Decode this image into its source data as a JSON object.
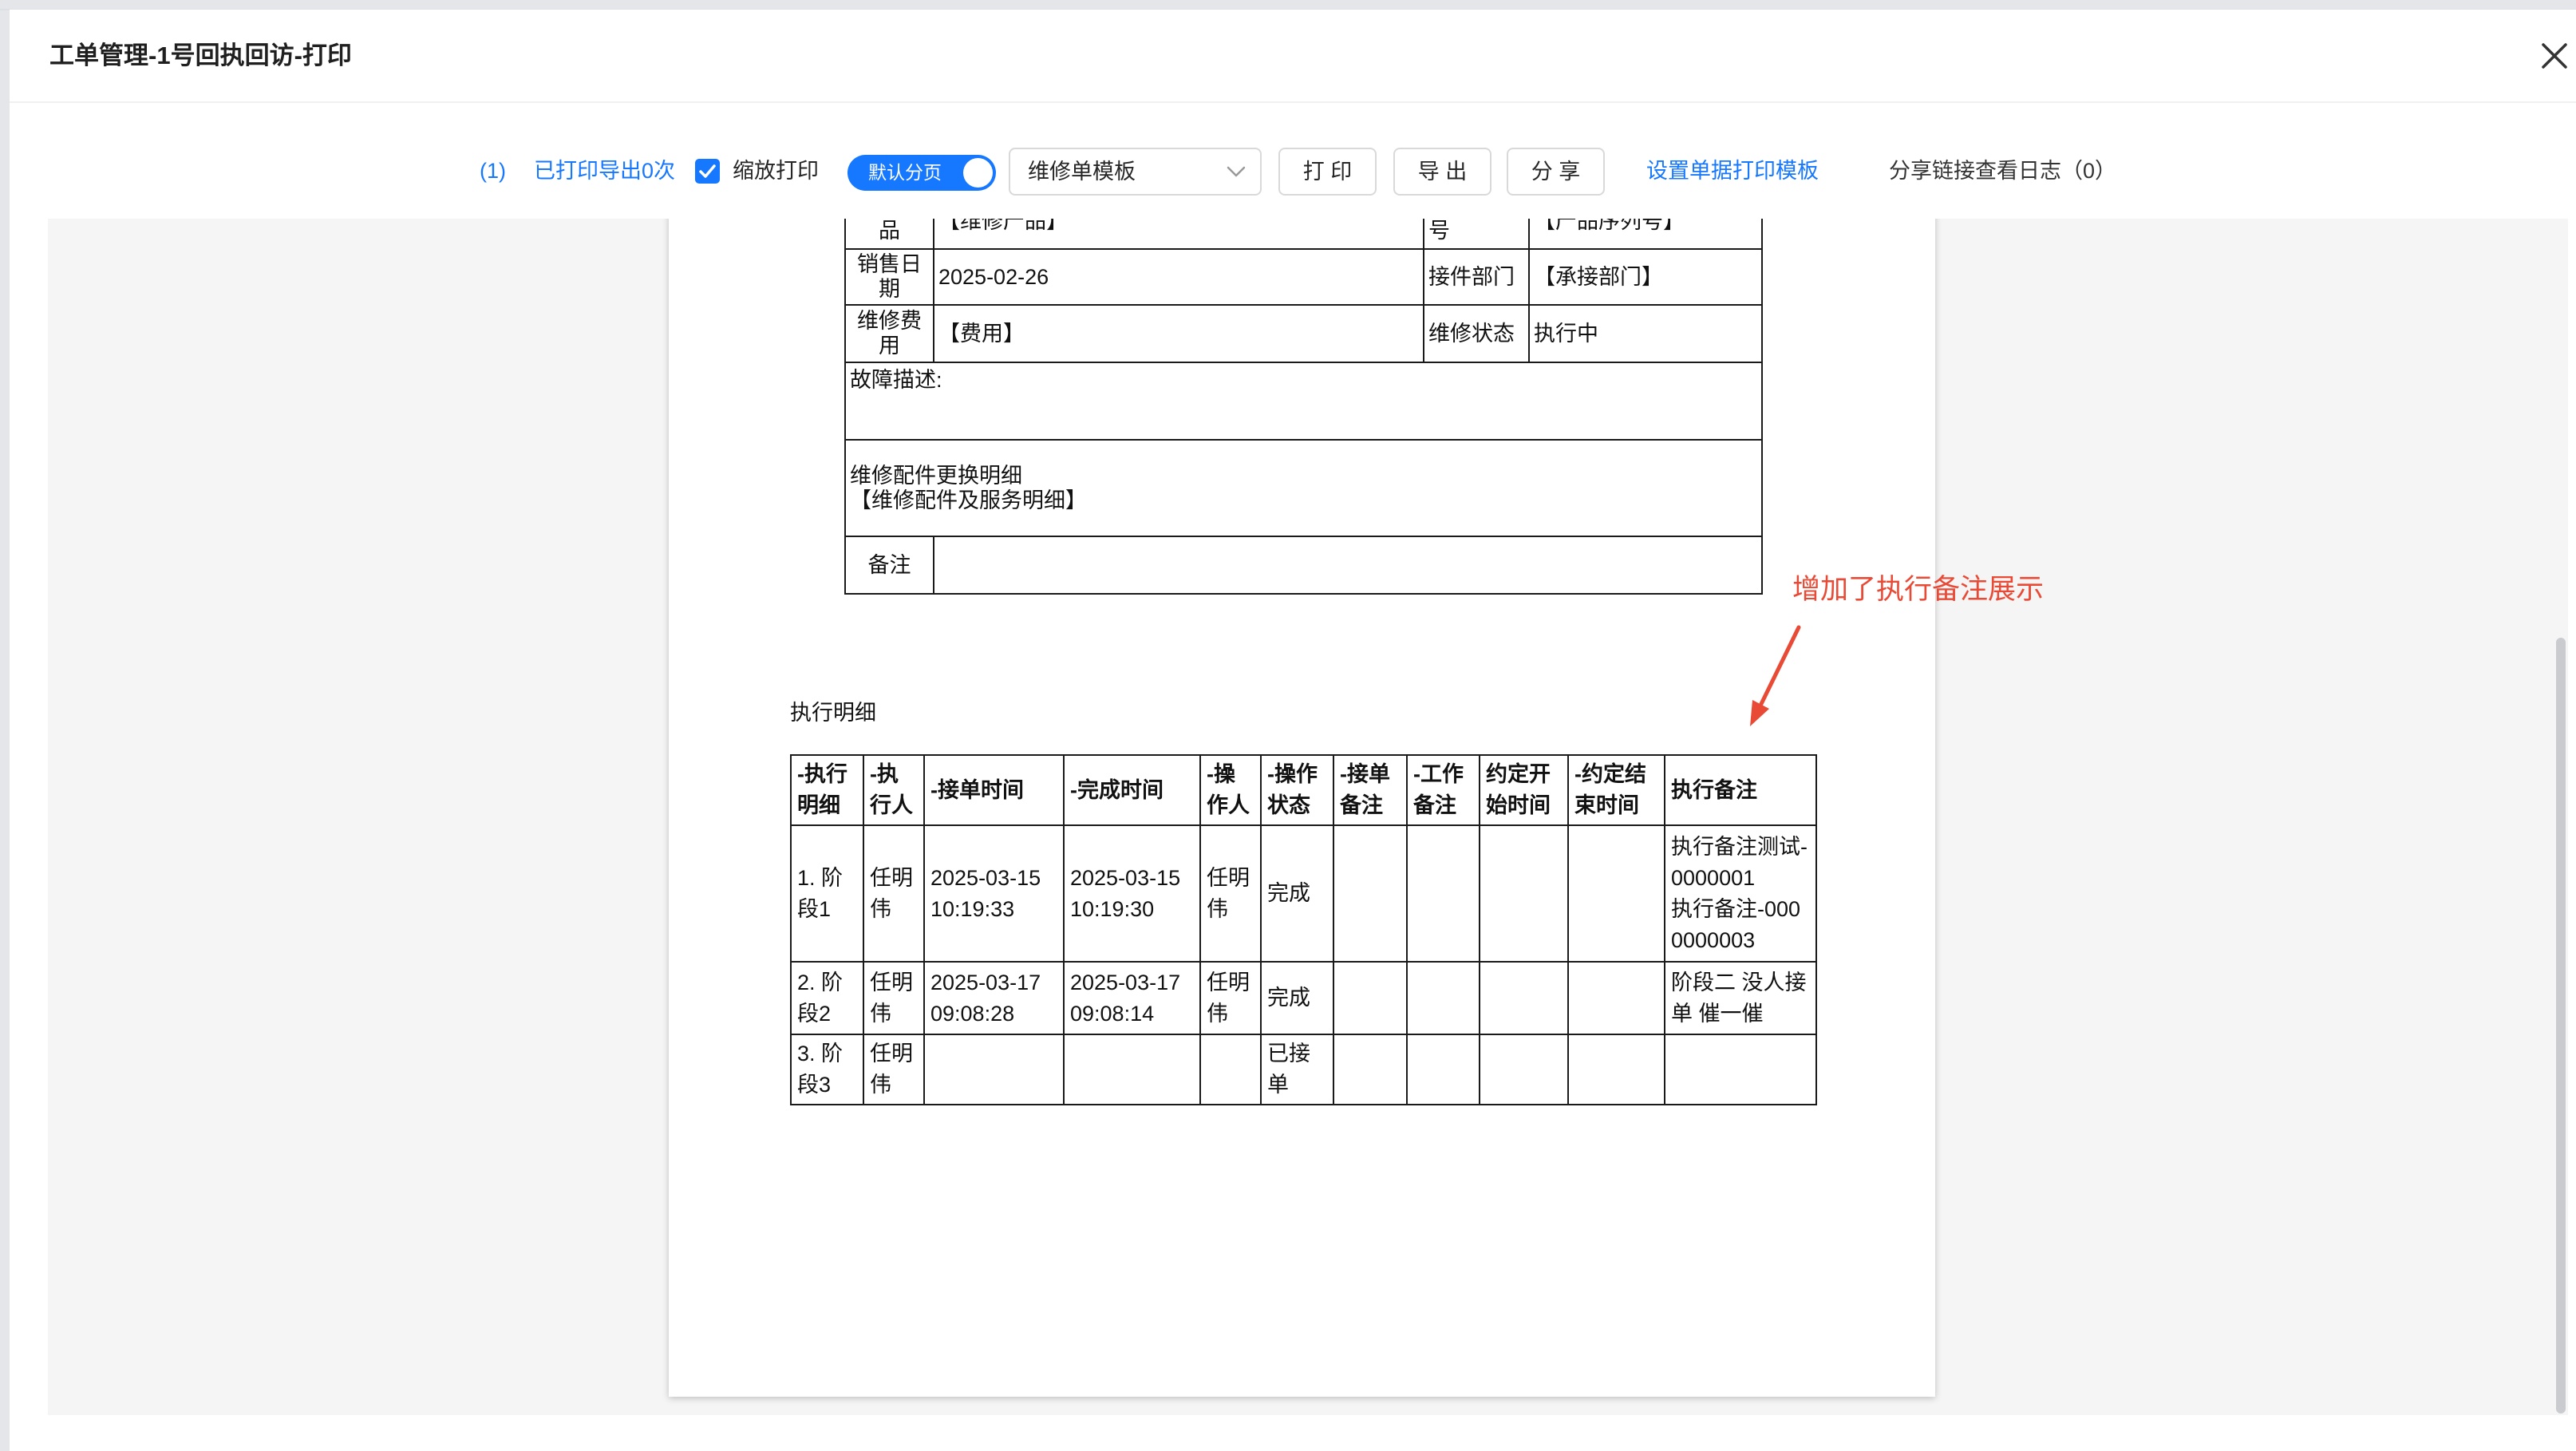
{
  "window": {
    "title": "工单管理-1号回执回访-打印"
  },
  "toolbar": {
    "print_index": "(1)",
    "print_export_count": "已打印导出0次",
    "zoom_print": {
      "label": "缩放打印",
      "checked": true
    },
    "default_pagination": {
      "label": "默认分页",
      "on": true
    },
    "template_select": {
      "value": "维修单模板"
    },
    "buttons": {
      "print": "打 印",
      "export": "导 出",
      "share": "分 享"
    },
    "links": {
      "set_print_template": "设置单据打印模板",
      "share_log": "分享链接查看日志（0）"
    }
  },
  "document": {
    "repair_info": {
      "rows": [
        {
          "label_1": "品",
          "value_1": "【维修产品】",
          "label_2": "号",
          "value_2": "【产品序列号】"
        },
        {
          "label_1": "销售日期",
          "value_1": "2025-02-26",
          "label_2": "接件部门",
          "value_2": "【承接部门】"
        },
        {
          "label_1": "维修费用",
          "value_1": "【费用】",
          "label_2": "维修状态",
          "value_2": "执行中"
        }
      ],
      "fault_description_label": "故障描述:",
      "parts_detail_label": "维修配件更换明细",
      "parts_detail_value": "【维修配件及服务明细】",
      "remarks_label": "备注",
      "remarks_value": ""
    },
    "execution_section_title": "执行明细",
    "execution_table": {
      "headers": [
        "-执行明细",
        "-执行人",
        "-接单时间",
        "-完成时间",
        "-操作人",
        "-操作状态",
        "-接单备注",
        "-工作备注",
        "约定开始时间",
        "-约定结束时间",
        "执行备注"
      ],
      "rows": [
        {
          "stage": "1. 阶段1",
          "executor": "任明伟",
          "accept_time": "2025-03-15 10:19:33",
          "complete_time": "2025-03-15 10:19:30",
          "operator": "任明伟",
          "operation_status": "完成",
          "accept_note": "",
          "work_note": "",
          "agreed_start": "",
          "agreed_end": "",
          "execution_notes": [
            "执行备注测试-0000001",
            "执行备注-0000000003"
          ]
        },
        {
          "stage": "2. 阶段2",
          "executor": "任明伟",
          "accept_time": "2025-03-17 09:08:28",
          "complete_time": "2025-03-17 09:08:14",
          "operator": "任明伟",
          "operation_status": "完成",
          "accept_note": "",
          "work_note": "",
          "agreed_start": "",
          "agreed_end": "",
          "execution_notes": [
            "阶段二 没人接单 催一催"
          ]
        },
        {
          "stage": "3. 阶段3",
          "executor": "任明伟",
          "accept_time": "",
          "complete_time": "",
          "operator": "",
          "operation_status": "已接单",
          "accept_note": "",
          "work_note": "",
          "agreed_start": "",
          "agreed_end": "",
          "execution_notes": []
        }
      ]
    }
  },
  "annotation": {
    "text": "增加了执行备注展示"
  },
  "colors": {
    "accent": "#1677ff",
    "annotation": "#e84a36",
    "content_background": "#f5f5f5",
    "table_border": "#1a1a1a"
  },
  "icons": {
    "close": "close-icon",
    "checkbox": "check-icon",
    "select": "chevron-down-icon",
    "annotation": "arrow-icon"
  }
}
